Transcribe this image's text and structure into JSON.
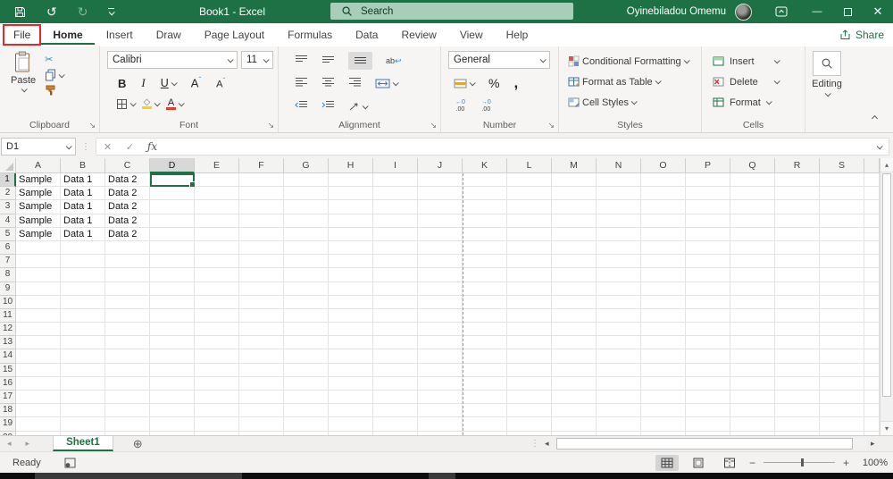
{
  "colors": {
    "excel_green": "#1e7145",
    "accent_green": "#1e7145",
    "file_highlight_red": "#ee2524",
    "search_box_green": "#a9cdb9",
    "fill_yellow": "#ffd400",
    "font_color_red": "#e03c31"
  },
  "glyphs": {
    "undo": "↺",
    "redo": "↻",
    "close": "✕",
    "minimize": "—",
    "scissors": "✂",
    "cancel_x": "✕",
    "check": "✓",
    "dots_v": "⋮",
    "launcher": "↘",
    "plus_circle": "⊕",
    "tri_left": "◂",
    "tri_right": "▸",
    "tri_up": "▴",
    "tri_down": "▾",
    "minus": "−",
    "plus": "+",
    "wrap_return": "↩",
    "fill_diamond": "◇",
    "caret_up": "ˆ",
    "caret_down": "ˇ"
  },
  "title_bar": {
    "title": "Book1 - Excel",
    "search_placeholder": "Search",
    "user_name": "Oyinebiladou Omemu"
  },
  "tab_row": {
    "tabs": [
      {
        "label": "File"
      },
      {
        "label": "Home"
      },
      {
        "label": "Insert"
      },
      {
        "label": "Draw"
      },
      {
        "label": "Page Layout"
      },
      {
        "label": "Formulas"
      },
      {
        "label": "Data"
      },
      {
        "label": "Review"
      },
      {
        "label": "View"
      },
      {
        "label": "Help"
      }
    ],
    "active_tab": "Home",
    "boxed_tab": "File",
    "share_label": "Share"
  },
  "ribbon": {
    "clipboard": {
      "label": "Clipboard",
      "paste_label": "Paste"
    },
    "font": {
      "label": "Font",
      "family": "Calibri",
      "size": "11",
      "bold": "B",
      "italic": "I",
      "underline": "U",
      "grow_shrink_letter": "A"
    },
    "alignment": {
      "label": "Alignment",
      "wrap_ab": "ab"
    },
    "number": {
      "label": "Number",
      "format": "General",
      "percent": "%",
      "comma": ",",
      "inc_top": "←0",
      "inc_bottom": ".00",
      "dec_top": "→0",
      "dec_bottom": ".00"
    },
    "styles": {
      "label": "Styles",
      "items": [
        "Conditional Formatting",
        "Format as Table",
        "Cell Styles"
      ]
    },
    "cells": {
      "label": "Cells",
      "items": [
        "Insert",
        "Delete",
        "Format"
      ]
    },
    "editing": {
      "label": "Editing"
    }
  },
  "formula_bar": {
    "name_box": "D1",
    "fx": "ƒx",
    "formula_value": ""
  },
  "grid": {
    "columns": [
      "A",
      "B",
      "C",
      "D",
      "E",
      "F",
      "G",
      "H",
      "I",
      "J",
      "K",
      "L",
      "M",
      "N",
      "O",
      "P",
      "Q",
      "R",
      "S"
    ],
    "total_rows": 20,
    "selected_cell": {
      "col": "D",
      "row": 1
    },
    "page_break_after_col": "J",
    "data_rows": [
      {
        "row": 1,
        "A": "Sample",
        "B": "Data 1",
        "C": "Data 2"
      },
      {
        "row": 2,
        "A": "Sample",
        "B": "Data 1",
        "C": "Data 2"
      },
      {
        "row": 3,
        "A": "Sample",
        "B": "Data 1",
        "C": "Data 2"
      },
      {
        "row": 4,
        "A": "Sample",
        "B": "Data 1",
        "C": "Data 2"
      },
      {
        "row": 5,
        "A": "Sample",
        "B": "Data 1",
        "C": "Data 2"
      }
    ]
  },
  "sheet_bar": {
    "active_tab": "Sheet1"
  },
  "status_bar": {
    "mode": "Ready",
    "zoom_level": "100%"
  }
}
